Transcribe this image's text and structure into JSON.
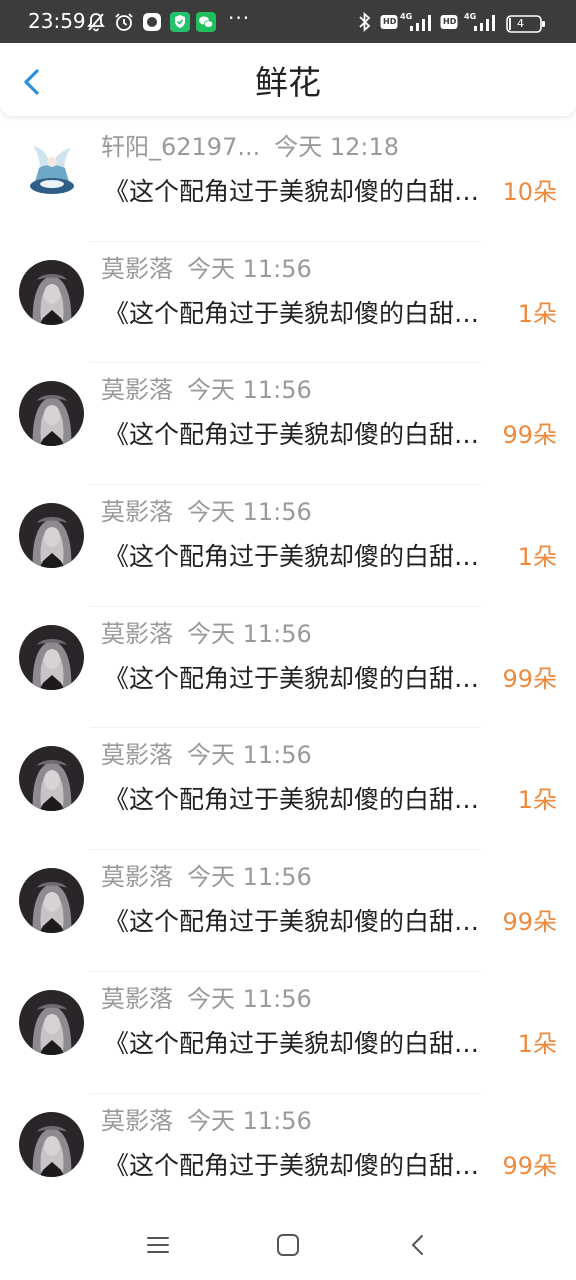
{
  "status_bar": {
    "time": "23:59",
    "dots": "···",
    "network_1": "4G",
    "network_2": "4G",
    "hd_label": "HD",
    "battery": "4"
  },
  "header": {
    "title": "鲜花",
    "back_icon": "chevron-left-icon"
  },
  "colors": {
    "accent": "#ee8a3d",
    "back_icon": "#2b8fe0",
    "meta_text": "#9a9a9a",
    "status_bar_bg": "#3c3c3c"
  },
  "gifts": [
    {
      "user": "轩阳_62197...",
      "time": "今天 12:18",
      "message": "《这个配角过于美貌却傻的白甜宝贝》",
      "count": "10朵",
      "avatar": "figure-avatar"
    },
    {
      "user": "莫影落",
      "time": "今天 11:56",
      "message": "《这个配角过于美貌却傻的白甜宝贝》",
      "count": "1朵",
      "avatar": "dark-portrait-avatar"
    },
    {
      "user": "莫影落",
      "time": "今天 11:56",
      "message": "《这个配角过于美貌却傻的白甜宝贝》",
      "count": "99朵",
      "avatar": "dark-portrait-avatar"
    },
    {
      "user": "莫影落",
      "time": "今天 11:56",
      "message": "《这个配角过于美貌却傻的白甜宝贝》",
      "count": "1朵",
      "avatar": "dark-portrait-avatar"
    },
    {
      "user": "莫影落",
      "time": "今天 11:56",
      "message": "《这个配角过于美貌却傻的白甜宝贝》",
      "count": "99朵",
      "avatar": "dark-portrait-avatar"
    },
    {
      "user": "莫影落",
      "time": "今天 11:56",
      "message": "《这个配角过于美貌却傻的白甜宝贝》",
      "count": "1朵",
      "avatar": "dark-portrait-avatar"
    },
    {
      "user": "莫影落",
      "time": "今天 11:56",
      "message": "《这个配角过于美貌却傻的白甜宝贝》",
      "count": "99朵",
      "avatar": "dark-portrait-avatar"
    },
    {
      "user": "莫影落",
      "time": "今天 11:56",
      "message": "《这个配角过于美貌却傻的白甜宝贝》",
      "count": "1朵",
      "avatar": "dark-portrait-avatar"
    },
    {
      "user": "莫影落",
      "time": "今天 11:56",
      "message": "《这个配角过于美貌却傻的白甜宝贝》",
      "count": "99朵",
      "avatar": "dark-portrait-avatar"
    }
  ],
  "nav_bar": {
    "menu_icon": "menu-icon",
    "home_icon": "home-icon",
    "back_icon": "back-icon"
  }
}
